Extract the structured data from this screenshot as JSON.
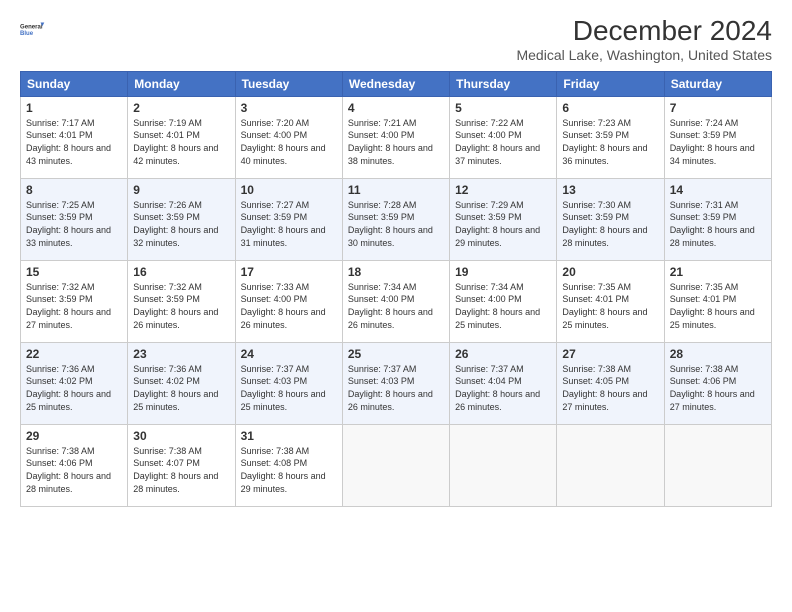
{
  "logo": {
    "line1": "General",
    "line2": "Blue"
  },
  "title": "December 2024",
  "subtitle": "Medical Lake, Washington, United States",
  "headers": [
    "Sunday",
    "Monday",
    "Tuesday",
    "Wednesday",
    "Thursday",
    "Friday",
    "Saturday"
  ],
  "weeks": [
    [
      {
        "day": "1",
        "sunrise": "7:17 AM",
        "sunset": "4:01 PM",
        "daylight": "8 hours and 43 minutes."
      },
      {
        "day": "2",
        "sunrise": "7:19 AM",
        "sunset": "4:01 PM",
        "daylight": "8 hours and 42 minutes."
      },
      {
        "day": "3",
        "sunrise": "7:20 AM",
        "sunset": "4:00 PM",
        "daylight": "8 hours and 40 minutes."
      },
      {
        "day": "4",
        "sunrise": "7:21 AM",
        "sunset": "4:00 PM",
        "daylight": "8 hours and 38 minutes."
      },
      {
        "day": "5",
        "sunrise": "7:22 AM",
        "sunset": "4:00 PM",
        "daylight": "8 hours and 37 minutes."
      },
      {
        "day": "6",
        "sunrise": "7:23 AM",
        "sunset": "3:59 PM",
        "daylight": "8 hours and 36 minutes."
      },
      {
        "day": "7",
        "sunrise": "7:24 AM",
        "sunset": "3:59 PM",
        "daylight": "8 hours and 34 minutes."
      }
    ],
    [
      {
        "day": "8",
        "sunrise": "7:25 AM",
        "sunset": "3:59 PM",
        "daylight": "8 hours and 33 minutes."
      },
      {
        "day": "9",
        "sunrise": "7:26 AM",
        "sunset": "3:59 PM",
        "daylight": "8 hours and 32 minutes."
      },
      {
        "day": "10",
        "sunrise": "7:27 AM",
        "sunset": "3:59 PM",
        "daylight": "8 hours and 31 minutes."
      },
      {
        "day": "11",
        "sunrise": "7:28 AM",
        "sunset": "3:59 PM",
        "daylight": "8 hours and 30 minutes."
      },
      {
        "day": "12",
        "sunrise": "7:29 AM",
        "sunset": "3:59 PM",
        "daylight": "8 hours and 29 minutes."
      },
      {
        "day": "13",
        "sunrise": "7:30 AM",
        "sunset": "3:59 PM",
        "daylight": "8 hours and 28 minutes."
      },
      {
        "day": "14",
        "sunrise": "7:31 AM",
        "sunset": "3:59 PM",
        "daylight": "8 hours and 28 minutes."
      }
    ],
    [
      {
        "day": "15",
        "sunrise": "7:32 AM",
        "sunset": "3:59 PM",
        "daylight": "8 hours and 27 minutes."
      },
      {
        "day": "16",
        "sunrise": "7:32 AM",
        "sunset": "3:59 PM",
        "daylight": "8 hours and 26 minutes."
      },
      {
        "day": "17",
        "sunrise": "7:33 AM",
        "sunset": "4:00 PM",
        "daylight": "8 hours and 26 minutes."
      },
      {
        "day": "18",
        "sunrise": "7:34 AM",
        "sunset": "4:00 PM",
        "daylight": "8 hours and 26 minutes."
      },
      {
        "day": "19",
        "sunrise": "7:34 AM",
        "sunset": "4:00 PM",
        "daylight": "8 hours and 25 minutes."
      },
      {
        "day": "20",
        "sunrise": "7:35 AM",
        "sunset": "4:01 PM",
        "daylight": "8 hours and 25 minutes."
      },
      {
        "day": "21",
        "sunrise": "7:35 AM",
        "sunset": "4:01 PM",
        "daylight": "8 hours and 25 minutes."
      }
    ],
    [
      {
        "day": "22",
        "sunrise": "7:36 AM",
        "sunset": "4:02 PM",
        "daylight": "8 hours and 25 minutes."
      },
      {
        "day": "23",
        "sunrise": "7:36 AM",
        "sunset": "4:02 PM",
        "daylight": "8 hours and 25 minutes."
      },
      {
        "day": "24",
        "sunrise": "7:37 AM",
        "sunset": "4:03 PM",
        "daylight": "8 hours and 25 minutes."
      },
      {
        "day": "25",
        "sunrise": "7:37 AM",
        "sunset": "4:03 PM",
        "daylight": "8 hours and 26 minutes."
      },
      {
        "day": "26",
        "sunrise": "7:37 AM",
        "sunset": "4:04 PM",
        "daylight": "8 hours and 26 minutes."
      },
      {
        "day": "27",
        "sunrise": "7:38 AM",
        "sunset": "4:05 PM",
        "daylight": "8 hours and 27 minutes."
      },
      {
        "day": "28",
        "sunrise": "7:38 AM",
        "sunset": "4:06 PM",
        "daylight": "8 hours and 27 minutes."
      }
    ],
    [
      {
        "day": "29",
        "sunrise": "7:38 AM",
        "sunset": "4:06 PM",
        "daylight": "8 hours and 28 minutes."
      },
      {
        "day": "30",
        "sunrise": "7:38 AM",
        "sunset": "4:07 PM",
        "daylight": "8 hours and 28 minutes."
      },
      {
        "day": "31",
        "sunrise": "7:38 AM",
        "sunset": "4:08 PM",
        "daylight": "8 hours and 29 minutes."
      },
      null,
      null,
      null,
      null
    ]
  ]
}
